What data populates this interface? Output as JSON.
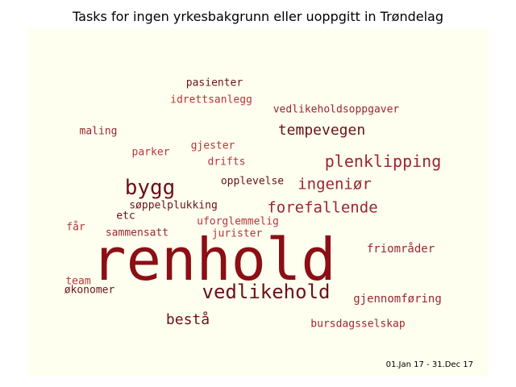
{
  "title": "Tasks for ingen yrkesbakgrunn eller uoppgitt in Trøndelag",
  "date_range": "01.Jan 17 - 31.Dec 17",
  "colors": {
    "canvas_background": "#fffff0",
    "darkest": "#8b0f14",
    "dark": "#6b1018",
    "medium": "#9a2530",
    "light": "#b8343a"
  },
  "words": [
    {
      "text": "renhold",
      "weight": 1.0,
      "color": "#8b0f14"
    },
    {
      "text": "vedlikehold",
      "weight": 0.38,
      "color": "#6b1018"
    },
    {
      "text": "bygg",
      "weight": 0.36,
      "color": "#6b1018"
    },
    {
      "text": "plenklipping",
      "weight": 0.3,
      "color": "#9a2530"
    },
    {
      "text": "forefallende",
      "weight": 0.28,
      "color": "#9a2530"
    },
    {
      "text": "ingeniør",
      "weight": 0.27,
      "color": "#9a2530"
    },
    {
      "text": "tempevegen",
      "weight": 0.26,
      "color": "#6b1018"
    },
    {
      "text": "bestå",
      "weight": 0.26,
      "color": "#6b1018"
    },
    {
      "text": "gjennomføring",
      "weight": 0.2,
      "color": "#9a2530"
    },
    {
      "text": "friområder",
      "weight": 0.2,
      "color": "#9a2530"
    },
    {
      "text": "bursdagsselskap",
      "weight": 0.19,
      "color": "#9a2530"
    },
    {
      "text": "vedlikeholdsoppgaver",
      "weight": 0.19,
      "color": "#9a2530"
    },
    {
      "text": "pasienter",
      "weight": 0.19,
      "color": "#6b1018"
    },
    {
      "text": "idrettsanlegg",
      "weight": 0.19,
      "color": "#b8343a"
    },
    {
      "text": "maling",
      "weight": 0.19,
      "color": "#9a2530"
    },
    {
      "text": "parker",
      "weight": 0.19,
      "color": "#b8343a"
    },
    {
      "text": "gjester",
      "weight": 0.19,
      "color": "#b8343a"
    },
    {
      "text": "drifts",
      "weight": 0.19,
      "color": "#b8343a"
    },
    {
      "text": "opplevelse",
      "weight": 0.19,
      "color": "#6b1018"
    },
    {
      "text": "søppelplukking",
      "weight": 0.19,
      "color": "#6b1018"
    },
    {
      "text": "etc",
      "weight": 0.19,
      "color": "#6b1018"
    },
    {
      "text": "uforglemmelig",
      "weight": 0.19,
      "color": "#b8343a"
    },
    {
      "text": "jurister",
      "weight": 0.19,
      "color": "#b8343a"
    },
    {
      "text": "får",
      "weight": 0.19,
      "color": "#b8343a"
    },
    {
      "text": "sammensatt",
      "weight": 0.19,
      "color": "#9a2530"
    },
    {
      "text": "team",
      "weight": 0.19,
      "color": "#b8343a"
    },
    {
      "text": "økonomer",
      "weight": 0.19,
      "color": "#6b1018"
    }
  ]
}
